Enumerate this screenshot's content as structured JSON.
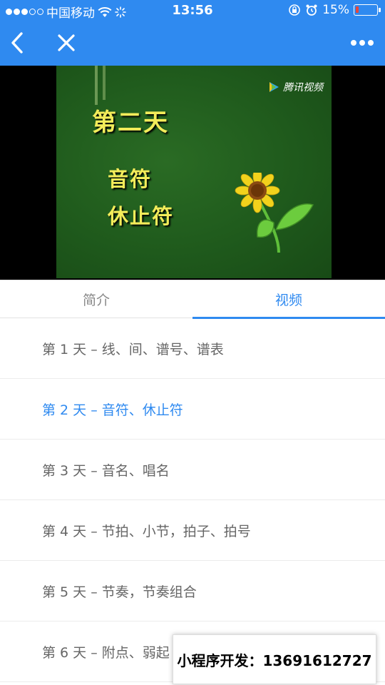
{
  "status_bar": {
    "carrier": "中国移动",
    "time": "13:56",
    "battery_percent_label": "15%",
    "battery_level": 0.15
  },
  "colors": {
    "accent": "#2f8af0",
    "video_text": "#f3ec5a",
    "battery_low": "#e8463a"
  },
  "nav": {
    "back_icon": "chevron-left-icon",
    "close_icon": "close-icon",
    "more_icon": "more-dots-icon"
  },
  "video": {
    "watermark": "腾讯视频",
    "title": "第二天",
    "lines": [
      "音符",
      "休止符"
    ]
  },
  "tabs": [
    {
      "label": "简介",
      "active": false
    },
    {
      "label": "视频",
      "active": true
    }
  ],
  "episodes": [
    {
      "label": "第 1 天 – 线、间、谱号、谱表",
      "active": false
    },
    {
      "label": "第 2 天 – 音符、休止符",
      "active": true
    },
    {
      "label": "第 3 天 – 音名、唱名",
      "active": false
    },
    {
      "label": "第 4 天 – 节拍、小节，拍子、拍号",
      "active": false
    },
    {
      "label": "第 5 天 – 节奏，节奏组合",
      "active": false
    },
    {
      "label": "第 6 天 – 附点、弱起",
      "active": false
    }
  ],
  "promo": {
    "text": "小程序开发：13691612727"
  }
}
